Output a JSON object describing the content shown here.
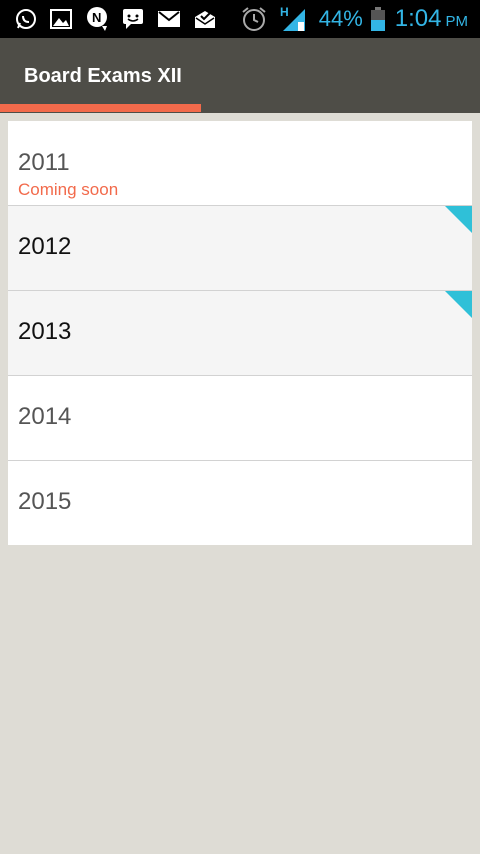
{
  "status_bar": {
    "icons": [
      "whatsapp-icon",
      "gallery-icon",
      "n-notification-icon",
      "chat-icon",
      "gmail-icon",
      "mail-check-icon"
    ],
    "network_label": "H",
    "battery_percent": "44%",
    "time": "1:04",
    "ampm": "PM",
    "accent_color": "#33b5e5"
  },
  "app_bar": {
    "title": "Board Exams XII",
    "background": "#4e4d47",
    "tab_indicator_color": "#f26a4b"
  },
  "list": {
    "items": [
      {
        "year": "2011",
        "subtitle": "Coming soon",
        "available": false
      },
      {
        "year": "2012",
        "subtitle": "",
        "available": true
      },
      {
        "year": "2013",
        "subtitle": "",
        "available": true
      },
      {
        "year": "2014",
        "subtitle": "",
        "available": false
      },
      {
        "year": "2015",
        "subtitle": "",
        "available": false
      }
    ],
    "corner_color": "#2fc0d8",
    "subtitle_color": "#f26a4b"
  }
}
